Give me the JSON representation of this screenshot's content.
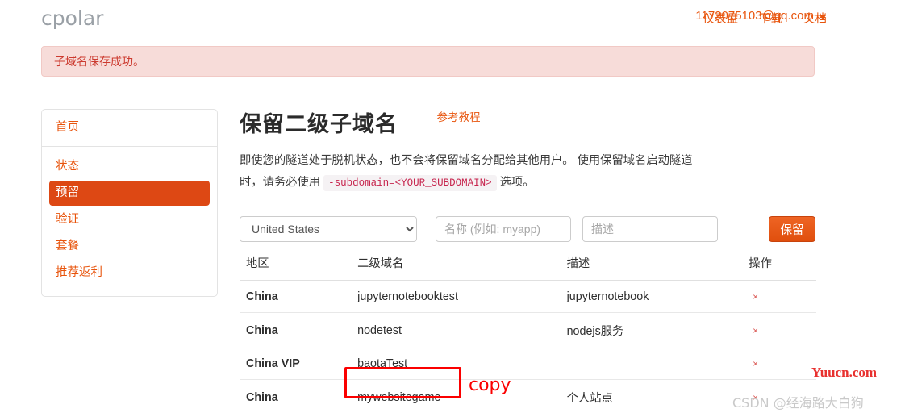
{
  "navbar": {
    "brand": "cpolar",
    "links": [
      {
        "label": "仪表盘"
      },
      {
        "label": "下载"
      },
      {
        "label": "文档"
      }
    ],
    "user": "1172075103@qq.com"
  },
  "alert": {
    "message": "子域名保存成功。",
    "bg_color": "#f7dcd9",
    "text_color": "#cc3b30"
  },
  "sidebar": {
    "header": "首页",
    "items": [
      {
        "label": "状态",
        "active": false
      },
      {
        "label": "预留",
        "active": true
      },
      {
        "label": "验证",
        "active": false
      },
      {
        "label": "套餐",
        "active": false
      },
      {
        "label": "推荐返利",
        "active": false
      }
    ],
    "active_color": "#dd4814"
  },
  "main": {
    "title": "保留二级子域名",
    "tutorial_link": "参考教程",
    "description_part1": "即使您的隧道处于脱机状态，也不会将保留域名分配给其他用户。 使用保留域名启动隧道时，请务必使用",
    "description_code": "-subdomain=<YOUR_SUBDOMAIN>",
    "description_part2": "选项。"
  },
  "form": {
    "region_selected": "United States",
    "name_placeholder": "名称 (例如: myapp)",
    "desc_placeholder": "描述",
    "name_value": "",
    "desc_value": "",
    "save_label": "保留",
    "save_color": "#e04f0d"
  },
  "table": {
    "headers": {
      "region": "地区",
      "subdomain": "二级域名",
      "description": "描述",
      "action": "操作"
    },
    "rows": [
      {
        "region": "China",
        "subdomain": "jupyternotebooktest",
        "description": "jupyternotebook",
        "action": "×"
      },
      {
        "region": "China",
        "subdomain": "nodetest",
        "description": "nodejs服务",
        "action": "×"
      },
      {
        "region": "China VIP",
        "subdomain": "baotaTest",
        "description": "",
        "action": "×"
      },
      {
        "region": "China",
        "subdomain": "mywebsitegame",
        "description": "个人站点",
        "action": "×"
      }
    ]
  },
  "annotations": {
    "copy_label": "copy",
    "highlight_color": "#fb0000"
  },
  "watermarks": {
    "red": "Yuucn.com",
    "gray": "CSDN @经海路大白狗"
  }
}
